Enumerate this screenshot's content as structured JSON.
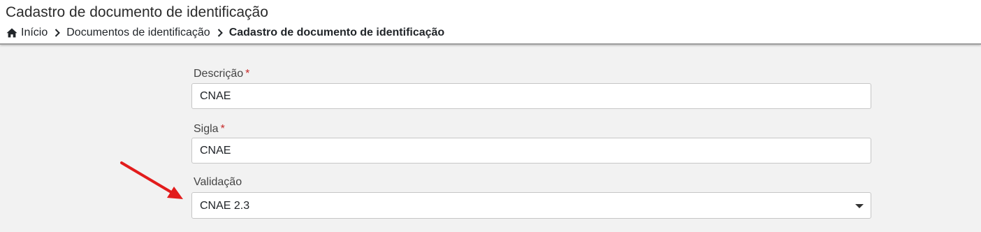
{
  "header": {
    "title": "Cadastro de documento de identificação",
    "breadcrumb": {
      "home_icon": "home-icon",
      "home_label": "Início",
      "separator_icon": "chevron-right-icon",
      "items": [
        "Documentos de identificação"
      ],
      "current": "Cadastro de documento de identificação"
    }
  },
  "form": {
    "descricao": {
      "label": "Descrição",
      "required_mark": "*",
      "value": "CNAE"
    },
    "sigla": {
      "label": "Sigla",
      "required_mark": "*",
      "value": "CNAE"
    },
    "validacao": {
      "label": "Validação",
      "selected": "CNAE 2.3",
      "icon": "caret-down-icon"
    }
  },
  "annotation": {
    "icon": "red-arrow-annotation",
    "color": "#e21c1c"
  },
  "colors": {
    "page_background": "#f2f2f2",
    "header_background": "#ffffff",
    "required": "#c62828"
  }
}
